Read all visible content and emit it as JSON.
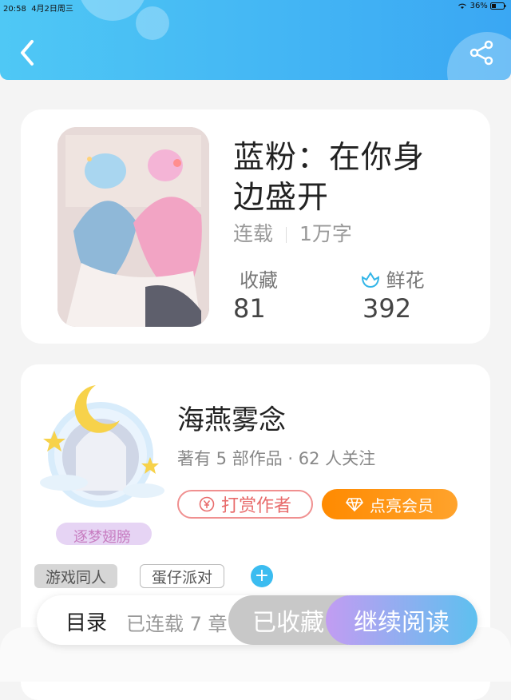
{
  "status_bar": {
    "time": "20:58",
    "date": "4月2日周三",
    "battery": "36%"
  },
  "header": {
    "back_icon": "chevron-left-icon",
    "share_icon": "share-icon"
  },
  "book": {
    "title_line1": "蓝粉：在你身",
    "title_line2": "边盛开",
    "status": "连载",
    "word_count": "1万字",
    "favorites_label": "收藏",
    "favorites_value": "81",
    "flowers_label": "鲜花",
    "flowers_value": "392"
  },
  "author": {
    "name": "海燕雾念",
    "meta": "著有 5 部作品 · 62 人关注",
    "badge": "逐梦翅膀",
    "tip_label": "打赏作者",
    "vip_label": "点亮会员"
  },
  "tags": [
    "游戏同人",
    "蛋仔派对"
  ],
  "bottom": {
    "toc_label": "目录",
    "toc_count": "已连载 7 章",
    "collected_label": "已收藏",
    "read_label": "继续阅读"
  },
  "colors": {
    "header": "#3aa7f3",
    "accent_orange": "#ff8a00",
    "tip_red": "#e86b6b"
  }
}
